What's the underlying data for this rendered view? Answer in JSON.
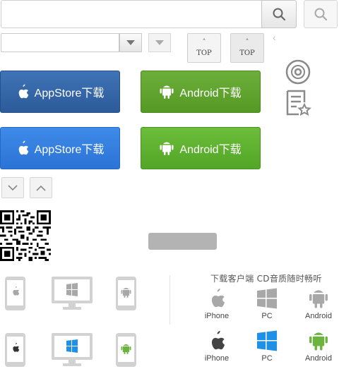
{
  "search": {
    "value": "",
    "placeholder": ""
  },
  "select": {
    "value": ""
  },
  "top_buttons": [
    {
      "label": "TOP"
    },
    {
      "label": "TOP"
    }
  ],
  "download_buttons": {
    "appstore_label": "AppStore下载",
    "android_label": "Android下载"
  },
  "client": {
    "title": "下载客户端 CD音质随时畅听",
    "platforms": [
      {
        "name": "iPhone"
      },
      {
        "name": "PC"
      },
      {
        "name": "Android"
      }
    ]
  },
  "colors": {
    "appstore_dark": "#2d5a9a",
    "appstore_light": "#2b73d6",
    "android_dark": "#559a24",
    "android_light": "#53a527",
    "icon_grey": "#a8a8a8",
    "pc_blue": "#1e90e6",
    "android_green": "#6db33f"
  },
  "icons": [
    "search-icon",
    "chevron-down-icon",
    "chevron-up-icon",
    "apple-icon",
    "android-icon",
    "windows-icon",
    "cd-icon",
    "list-star-icon",
    "qr-code"
  ]
}
